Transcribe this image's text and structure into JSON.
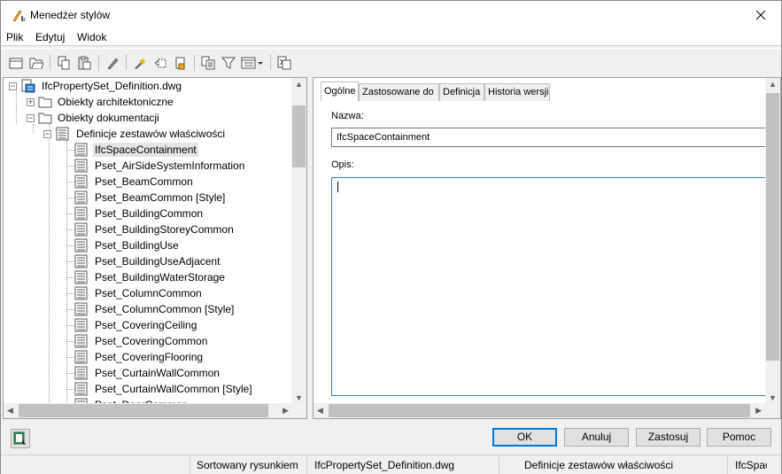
{
  "window": {
    "title": "Menedżer stylów",
    "close_icon": "close-icon"
  },
  "menu": [
    "Plik",
    "Edytuj",
    "Widok"
  ],
  "toolbar_icons": [
    "new-style-icon",
    "open-drawing-icon",
    "copy-icon",
    "paste-icon",
    "edit-style-icon",
    "purge-styles-icon",
    "toggle-view-icon",
    "set-from-icon",
    "sort-icon",
    "filter-icon",
    "view-options-icon",
    "inplace-edit-icon"
  ],
  "tree": {
    "root": "IfcPropertySet_Definition.dwg",
    "arch_objects": "Obiekty architektoniczne",
    "doc_objects": "Obiekty dokumentacji",
    "psetdefs": "Definicje zestawów właściwości",
    "items": [
      "IfcSpaceContainment",
      "Pset_AirSideSystemInformation",
      "Pset_BeamCommon",
      "Pset_BeamCommon [Style]",
      "Pset_BuildingCommon",
      "Pset_BuildingStoreyCommon",
      "Pset_BuildingUse",
      "Pset_BuildingUseAdjacent",
      "Pset_BuildingWaterStorage",
      "Pset_ColumnCommon",
      "Pset_ColumnCommon [Style]",
      "Pset_CoveringCeiling",
      "Pset_CoveringCommon",
      "Pset_CoveringFlooring",
      "Pset_CurtainWallCommon",
      "Pset_CurtainWallCommon [Style]",
      "Pset_DoorCommon"
    ]
  },
  "tabs": [
    "Ogólne",
    "Zastosowane do",
    "Definicja",
    "Historia wersji"
  ],
  "form": {
    "name_label": "Nazwa:",
    "name_value": "IfcSpaceContainment",
    "desc_label": "Opis:",
    "desc_value": ""
  },
  "buttons": {
    "ok": "OK",
    "cancel": "Anuluj",
    "apply": "Zastosuj",
    "help": "Pomoc"
  },
  "status": {
    "sort": "Sortowany rysunkiem",
    "file": "IfcPropertySet_Definition.dwg",
    "category": "Definicje zestawów właściwości",
    "item": "IfcSpaceContainment"
  },
  "colors": {
    "accent": "#0078d7",
    "selection": "#e5e5e5"
  }
}
